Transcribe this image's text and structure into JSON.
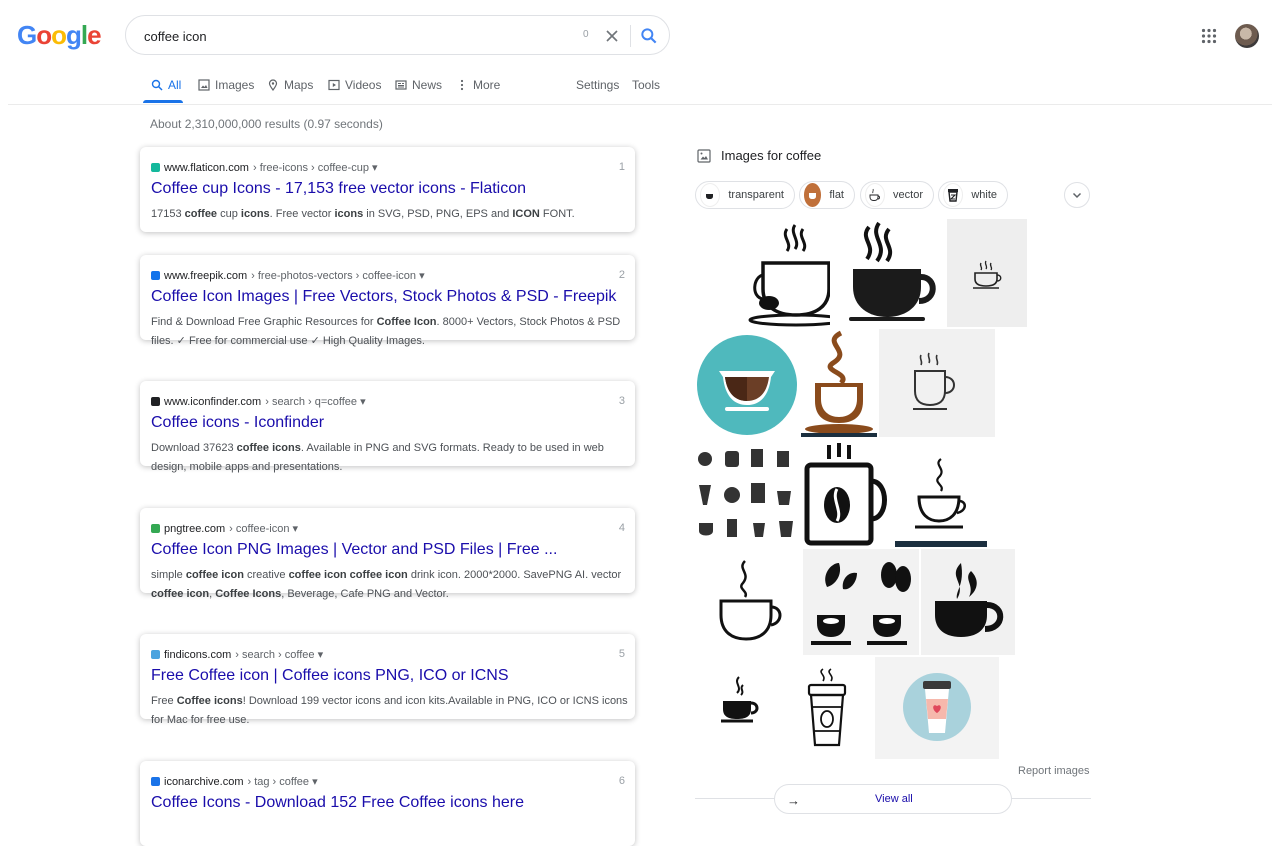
{
  "logo": {
    "letters": [
      "G",
      "o",
      "o",
      "g",
      "l",
      "e"
    ],
    "colors": [
      "#4285f4",
      "#ea4335",
      "#fbbc05",
      "#4285f4",
      "#34a853",
      "#ea4335"
    ]
  },
  "search": {
    "value": "coffee icon",
    "count_hint": "0"
  },
  "tabs": [
    {
      "label": "All",
      "icon": "search-icon",
      "active": true
    },
    {
      "label": "Images",
      "icon": "image-icon"
    },
    {
      "label": "Maps",
      "icon": "map-pin-icon"
    },
    {
      "label": "Videos",
      "icon": "video-icon"
    },
    {
      "label": "News",
      "icon": "news-icon"
    },
    {
      "label": "More",
      "icon": "more-vert-icon"
    },
    {
      "label": "Settings"
    },
    {
      "label": "Tools"
    }
  ],
  "stats": "About 2,310,000,000 results (0.97 seconds)",
  "results": [
    {
      "domain": "www.flaticon.com",
      "path": " › free-icons › coffee-cup ▾",
      "num": "1",
      "title": "Coffee cup Icons - 17,153 free vector icons - Flaticon",
      "snippet": "17153 <b>coffee</b> cup <b>icons</b>. Free vector <b>icons</b> in SVG, PSD, PNG, EPS and <b>ICON</b> FONT.",
      "fav_color": "#14b89c"
    },
    {
      "domain": "www.freepik.com",
      "path": " › free-photos-vectors › coffee-icon ▾",
      "num": "2",
      "title": "Coffee Icon Images | Free Vectors, Stock Photos & PSD - Freepik",
      "snippet": "Find & Download Free Graphic Resources for <b>Coffee Icon</b>. 8000+ Vectors, Stock Photos & PSD files. ✓ Free for commercial use ✓ High Quality Images.",
      "fav_color": "#1273eb"
    },
    {
      "domain": "www.iconfinder.com",
      "path": " › search › q=coffee ▾",
      "num": "3",
      "title": "Coffee icons - Iconfinder",
      "snippet": "Download 37623 <b>coffee icons</b>. Available in PNG and SVG formats. Ready to be used in web design, mobile apps and presentations.",
      "fav_color": "#202124"
    },
    {
      "domain": "pngtree.com",
      "path": " › coffee-icon ▾",
      "num": "4",
      "title": "Coffee Icon PNG Images | Vector and PSD Files | Free ...",
      "snippet": "simple <b>coffee icon</b> creative <b>coffee icon coffee icon</b> drink icon. 2000*2000. SavePNG AI. vector <b>coffee icon</b>, <b>Coffee Icons</b>, Beverage, Cafe PNG and Vector.",
      "fav_color": "#34a853"
    },
    {
      "domain": "findicons.com",
      "path": " › search › coffee ▾",
      "num": "5",
      "title": "Free Coffee icon | Coffee icons PNG, ICO or ICNS",
      "snippet": "Free <b>Coffee icons</b>! Download 199 vector icons and icon kits.Available in PNG, ICO or ICNS icons for Mac for free use.",
      "fav_color": "#4aa3df"
    },
    {
      "domain": "iconarchive.com",
      "path": " › tag › coffee ▾",
      "num": "6",
      "title": "Coffee Icons - Download 152 Free Coffee icons here",
      "snippet": "",
      "fav_color": "#1a73e8"
    }
  ],
  "images_panel": {
    "heading": "Images for coffee",
    "chips": [
      {
        "label": "transparent"
      },
      {
        "label": "flat"
      },
      {
        "label": "vector"
      },
      {
        "label": "white"
      }
    ],
    "report": "Report images",
    "view_all": "View all"
  }
}
